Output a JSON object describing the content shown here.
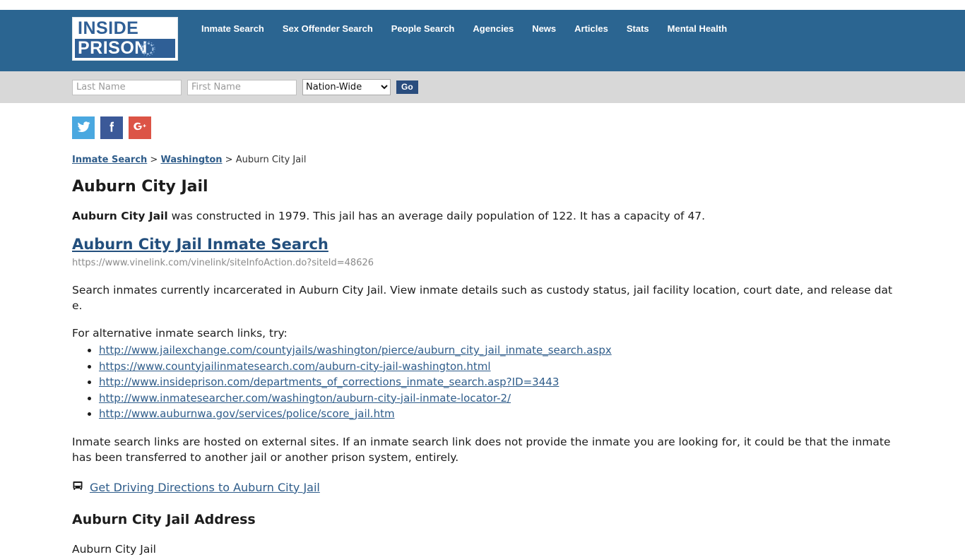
{
  "site": {
    "logo_line1": "INSIDE",
    "logo_line2": "PRISON"
  },
  "nav": {
    "items": [
      {
        "label": "Inmate Search"
      },
      {
        "label": "Sex Offender Search"
      },
      {
        "label": "People Search"
      },
      {
        "label": "Agencies"
      },
      {
        "label": "News"
      },
      {
        "label": "Articles"
      },
      {
        "label": "Stats"
      },
      {
        "label": "Mental Health"
      }
    ]
  },
  "search": {
    "last_name_placeholder": "Last Name",
    "last_name_value": "",
    "first_name_placeholder": "First Name",
    "first_name_value": "",
    "scope_selected": "Nation-Wide",
    "scope_options": [
      "Nation-Wide"
    ],
    "go_label": "Go"
  },
  "social": {
    "twitter_label": "Twitter",
    "facebook_label": "Facebook",
    "google_label": "Google Plus",
    "twitter_color": "#4aa8e0",
    "facebook_color": "#3b5998",
    "google_color": "#dc5446"
  },
  "breadcrumb": {
    "item1": "Inmate Search",
    "sep1": ">",
    "item2": "Washington",
    "sep2": ">",
    "current": "Auburn City Jail"
  },
  "page": {
    "title": "Auburn City Jail",
    "intro_bold": "Auburn City Jail",
    "intro_rest": " was constructed in 1979. This jail has an average daily population of 122. It has a capacity of 47.",
    "search_heading": "Auburn City Jail Inmate Search",
    "search_url": "https://www.vinelink.com/vinelink/siteInfoAction.do?siteId=48626",
    "description": "Search inmates currently incarcerated in Auburn City Jail. View inmate details such as custody status, jail facility location, court date, and release date.",
    "alt_links_label": "For alternative inmate search links, try:",
    "alt_links": [
      {
        "url": "http://www.jailexchange.com/countyjails/washington/pierce/auburn_city_jail_inmate_search.aspx"
      },
      {
        "url": "https://www.countyjailinmatesearch.com/auburn-city-jail-washington.html"
      },
      {
        "url": "http://www.insideprison.com/departments_of_corrections_inmate_search.asp?ID=3443"
      },
      {
        "url": "http://www.inmatesearcher.com/washington/auburn-city-jail-inmate-locator-2/"
      },
      {
        "url": "http://www.auburnwa.gov/services/police/score_jail.htm"
      }
    ],
    "disclaimer": "Inmate search links are hosted on external sites. If an inmate search link does not provide the inmate you are looking for, it could be that the inmate has been transferred to another jail or another prison system, entirely.",
    "directions_label": "Get Driving Directions to Auburn City Jail",
    "address_heading": "Auburn City Jail Address",
    "address_line1": "Auburn City Jail"
  },
  "colors": {
    "header_blue": "#2b6591",
    "search_band_gray": "#d8d8d8",
    "link_blue": "#2e5c8a",
    "go_button": "#2a4d7e"
  }
}
